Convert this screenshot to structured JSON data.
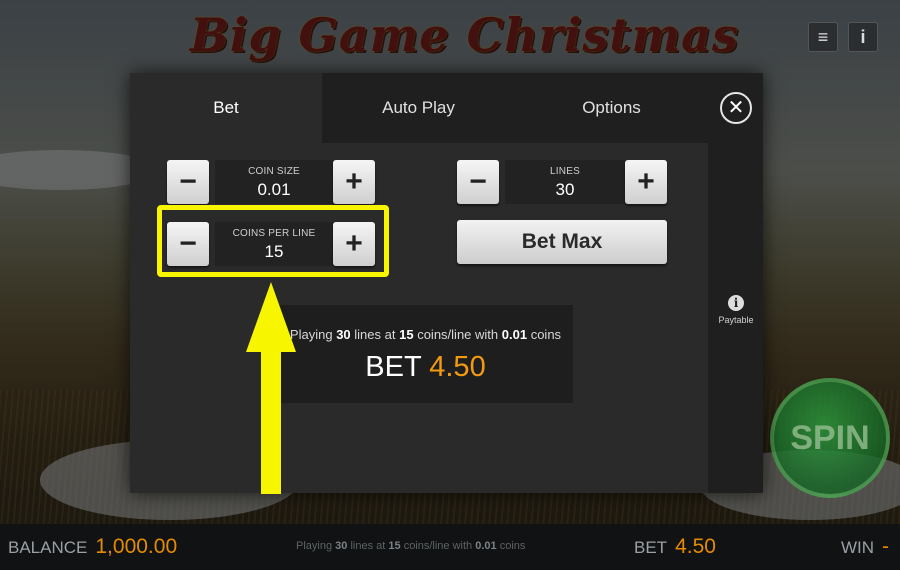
{
  "game": {
    "title": "Big Game Christmas"
  },
  "top_icons": {
    "menu": "≡",
    "info": "i"
  },
  "tabs": [
    {
      "label": "Bet",
      "active": true
    },
    {
      "label": "Auto Play",
      "active": false
    },
    {
      "label": "Options",
      "active": false
    }
  ],
  "close": {
    "glyph": "✕"
  },
  "coin_size": {
    "label": "COIN SIZE",
    "value": "0.01",
    "minus": "−",
    "plus": "+"
  },
  "coins_per_line": {
    "label": "COINS PER LINE",
    "value": "15",
    "minus": "−",
    "plus": "+"
  },
  "lines": {
    "label": "LINES",
    "value": "30",
    "minus": "−",
    "plus": "+"
  },
  "bet_max": {
    "label": "Bet Max"
  },
  "summary": {
    "prefix": "Playing",
    "lines": "30",
    "mid1": "lines at",
    "coins": "15",
    "mid2": "coins/line with",
    "coin_size": "0.01",
    "suffix": "coins",
    "bet_label": "BET",
    "bet_value": "4.50"
  },
  "paytable": {
    "icon": "i",
    "label": "Paytable"
  },
  "spin": {
    "label": "SPIN"
  },
  "bottom_bar": {
    "balance_label": "BALANCE",
    "balance_value": "1,000.00",
    "info_prefix": "Playing",
    "info_lines": "30",
    "info_mid1": "lines at",
    "info_coins": "15",
    "info_mid2": "coins/line with",
    "info_coin_size": "0.01",
    "info_suffix": "coins",
    "bet_label": "BET",
    "bet_value": "4.50",
    "win_label": "WIN",
    "win_value": "-"
  },
  "colors": {
    "accent": "#f39a10",
    "highlight": "#f7f500",
    "spin": "#1f8a33"
  },
  "icons": [
    "menu-icon",
    "info-icon",
    "close-icon",
    "minus-icon",
    "plus-icon",
    "paytable-info-icon",
    "spin-arrows-icon",
    "annotation-arrow"
  ]
}
